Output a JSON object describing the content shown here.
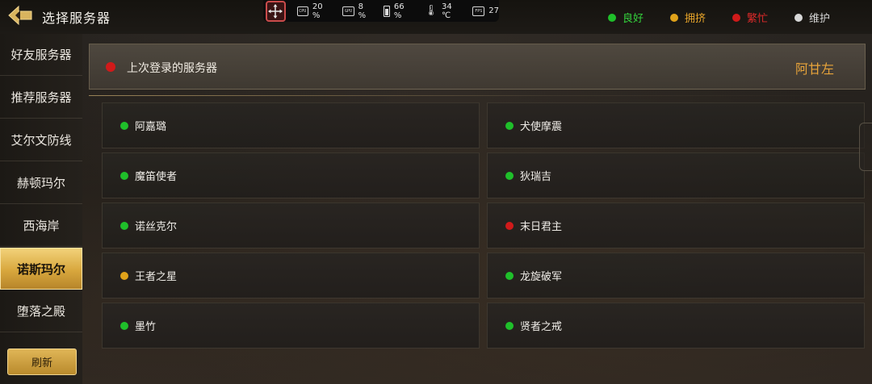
{
  "header": {
    "title": "选择服务器"
  },
  "perf_overlay": {
    "cpu_chip": "CPU",
    "cpu": "20 %",
    "gpu_chip": "GPU",
    "gpu": "8 %",
    "battery": "66 %",
    "temp": "34 ℃",
    "fps_chip": "FPS",
    "fps": "27"
  },
  "legend": {
    "good": "良好",
    "crowded": "拥挤",
    "busy": "繁忙",
    "maintenance": "维护"
  },
  "colors": {
    "good": "#1fbf2a",
    "crowded": "#e0a21a",
    "busy": "#d01a1a",
    "maintenance": "#d8d8d8",
    "accent": "#e8a43a"
  },
  "sidebar": {
    "items": [
      {
        "label": "好友服务器"
      },
      {
        "label": "推荐服务器"
      },
      {
        "label": "艾尔文防线"
      },
      {
        "label": "赫顿玛尔"
      },
      {
        "label": "西海岸"
      },
      {
        "label": "诺斯玛尔",
        "active": true
      },
      {
        "label": "堕落之殿"
      }
    ],
    "refresh_label": "刷新"
  },
  "last_login": {
    "label": "上次登录的服务器",
    "server": "阿甘左",
    "status": "busy"
  },
  "servers": [
    {
      "name": "阿嘉璐",
      "status": "good"
    },
    {
      "name": "犬使摩震",
      "status": "good"
    },
    {
      "name": "魔笛使者",
      "status": "good"
    },
    {
      "name": "狄瑞吉",
      "status": "good"
    },
    {
      "name": "诺丝克尔",
      "status": "good"
    },
    {
      "name": "末日君主",
      "status": "busy"
    },
    {
      "name": "王者之星",
      "status": "crowded"
    },
    {
      "name": "龙旋破军",
      "status": "good"
    },
    {
      "name": "墨竹",
      "status": "good"
    },
    {
      "name": "贤者之戒",
      "status": "good"
    }
  ]
}
